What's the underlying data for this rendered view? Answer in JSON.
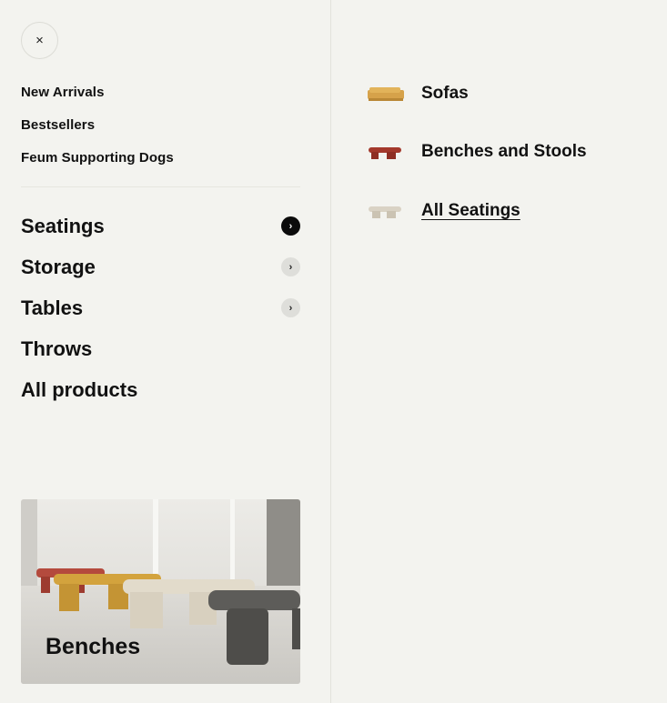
{
  "menu": {
    "close_icon": "×",
    "quick_links": [
      "New Arrivals",
      "Bestsellers",
      "Feum Supporting Dogs"
    ],
    "categories": [
      {
        "label": "Seatings",
        "chevron": "›",
        "state": "active"
      },
      {
        "label": "Storage",
        "chevron": "›",
        "state": "inactive"
      },
      {
        "label": "Tables",
        "chevron": "›",
        "state": "inactive"
      },
      {
        "label": "Throws"
      },
      {
        "label": "All products"
      }
    ],
    "promo": {
      "label": "Benches"
    }
  },
  "submenu": {
    "items": [
      {
        "label": "Sofas",
        "icon": "sofa-thumbnail-icon",
        "color": "#d6a24a"
      },
      {
        "label": "Benches and Stools",
        "icon": "bench-thumbnail-icon",
        "color": "#a3382b"
      },
      {
        "label": "All Seatings",
        "icon": "seating-thumbnail-icon",
        "color": "#d9d2c4"
      }
    ]
  },
  "colors": {
    "background": "#f3f3ef",
    "active_chevron": "#0b0b0b",
    "inactive_chevron": "#dededa"
  }
}
